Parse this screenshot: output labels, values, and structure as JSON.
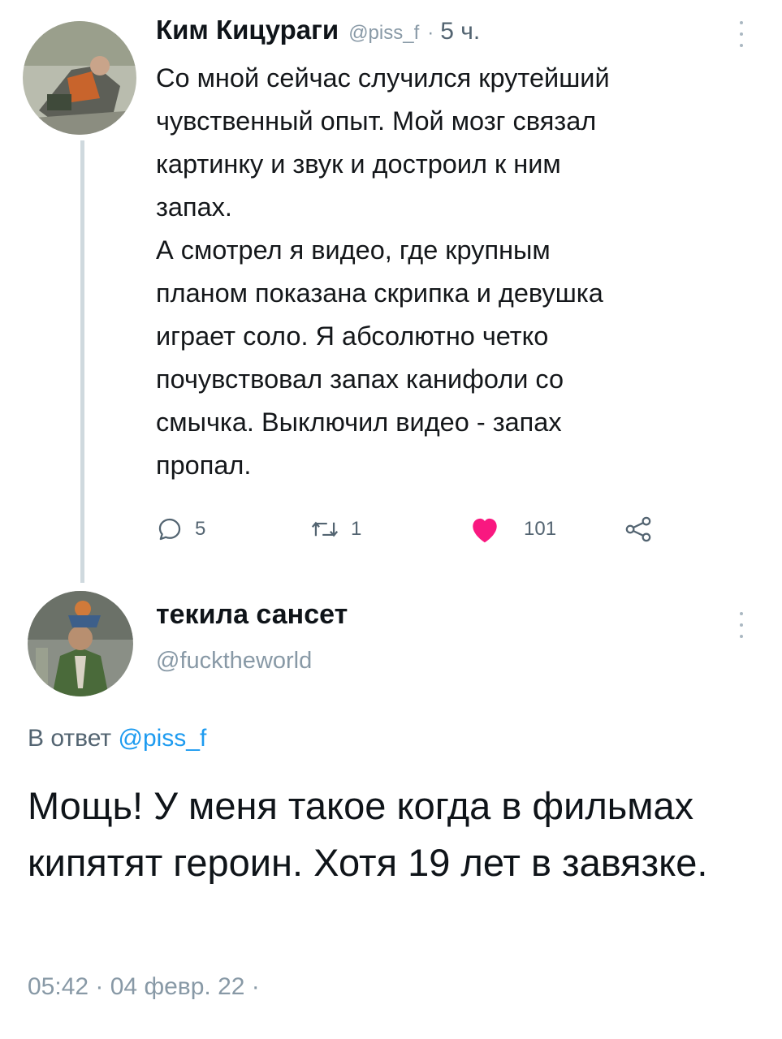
{
  "tweet1": {
    "display_name": "Ким Кицураги",
    "handle": "@piss_f",
    "separator": "·",
    "time": "5 ч.",
    "text": "Со мной сейчас случился крутейший\nчувственный опыт. Мой мозг связал\nкартинку и звук и достроил к ним\nзапах.\nА смотрел я видео, где крупным\nпланом показана скрипка и девушка\nиграет соло. Я абсолютно четко\nпочувствовал запах канифоли со\nсмычка. Выключил видео - запах\nпропал.",
    "actions": {
      "reply_count": "5",
      "retweet_count": "1",
      "like_count": "101"
    },
    "icons": {
      "reply": "reply-icon",
      "retweet": "retweet-icon",
      "like": "heart-icon",
      "share": "share-icon",
      "more": "more-vertical-icon"
    }
  },
  "tweet2": {
    "display_name": "текила сансет",
    "handle": "@fucktheworld",
    "reply_prefix": "В ответ",
    "reply_mention": "@piss_f",
    "text": "Мощь! У меня такое когда в фильмах кипятят героин. Хотя 19 лет в завязке.",
    "timestamp": "05:42 · 04 февр. 22 ·"
  },
  "colors": {
    "like": "#f91880",
    "link": "#1d9bf0",
    "secondary_text": "#536471",
    "thread_line": "#cfd9de"
  }
}
